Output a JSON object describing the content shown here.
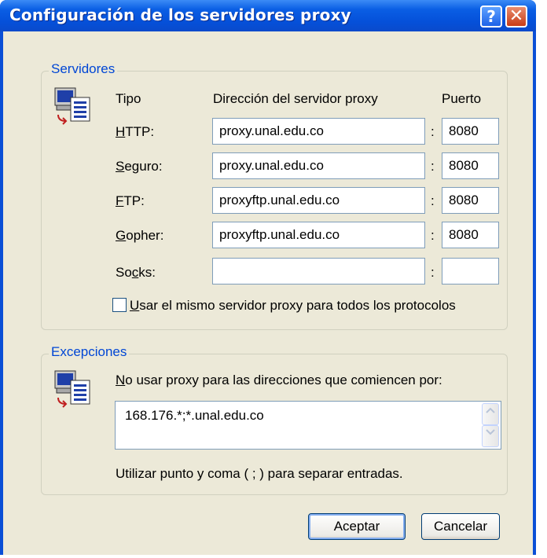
{
  "window": {
    "title": "Configuración de los servidores proxy",
    "help_button": "?",
    "close_button": "✕"
  },
  "servers": {
    "group_label": "Servidores",
    "col_type": "Tipo",
    "col_address": "Dirección del servidor proxy",
    "col_port": "Puerto",
    "rows": [
      {
        "label_ul": "H",
        "label_rest": "TTP:",
        "address": "proxy.unal.edu.co",
        "port": "8080"
      },
      {
        "label_ul": "S",
        "label_rest": "eguro:",
        "address": "proxy.unal.edu.co",
        "port": "8080"
      },
      {
        "label_ul": "F",
        "label_rest": "TP:",
        "address": "proxyftp.unal.edu.co",
        "port": "8080"
      },
      {
        "label_ul": "G",
        "label_rest": "opher:",
        "address": "proxyftp.unal.edu.co",
        "port": "8080"
      },
      {
        "label_pre": "So",
        "label_ul": "c",
        "label_rest": "ks:",
        "address": "",
        "port": ""
      }
    ],
    "same_proxy_ul": "U",
    "same_proxy_rest": "sar el mismo servidor proxy para todos los protocolos",
    "same_proxy_checked": false
  },
  "exceptions": {
    "group_label": "Excepciones",
    "prompt_ul": "N",
    "prompt_rest": "o usar proxy para las direcciones que comiencen por:",
    "value": "168.176.*;*.unal.edu.co",
    "hint": "Utilizar punto y coma ( ; ) para separar entradas."
  },
  "buttons": {
    "accept": "Aceptar",
    "cancel": "Cancelar"
  },
  "colors": {
    "titlebar": "#0a5ee4",
    "group_label": "#0046d5",
    "dialog_bg": "#ece9d8"
  }
}
